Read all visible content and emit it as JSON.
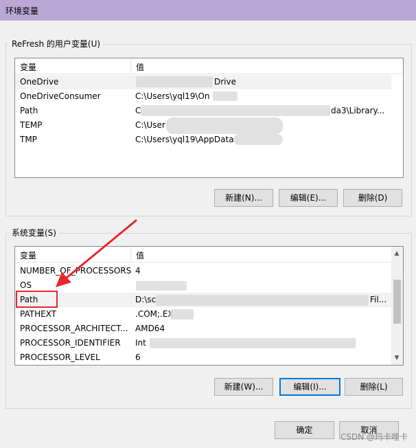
{
  "window": {
    "title": "环境变量"
  },
  "user_vars": {
    "label": "ReFresh 的用户变量(U)",
    "headers": [
      "变量",
      "值"
    ],
    "rows": [
      {
        "name": "OneDrive",
        "value": "Drive"
      },
      {
        "name": "OneDriveConsumer",
        "value": "C:\\Users\\yql19\\On"
      },
      {
        "name": "Path",
        "value": "C",
        "value_tail": "da3\\Library..."
      },
      {
        "name": "TEMP",
        "value": "C:\\User"
      },
      {
        "name": "TMP",
        "value": "C:\\Users\\yql19\\AppData"
      }
    ],
    "buttons": {
      "new": "新建(N)...",
      "edit": "编辑(E)...",
      "delete": "删除(D)"
    }
  },
  "system_vars": {
    "label": "系统变量(S)",
    "headers": [
      "变量",
      "值"
    ],
    "rows": [
      {
        "name": "NUMBER_OF_PROCESSORS",
        "value": "4"
      },
      {
        "name": "OS",
        "value": ""
      },
      {
        "name": "Path",
        "value": "D:\\sc",
        "value_tail": "Fil..."
      },
      {
        "name": "PATHEXT",
        "value": ".COM;.EX"
      },
      {
        "name": "PROCESSOR_ARCHITECT...",
        "value": "AMD64"
      },
      {
        "name": "PROCESSOR_IDENTIFIER",
        "value": "Int"
      },
      {
        "name": "PROCESSOR_LEVEL",
        "value": "6"
      }
    ],
    "buttons": {
      "new": "新建(W)...",
      "edit": "编辑(I)...",
      "delete": "删除(L)"
    }
  },
  "footer": {
    "ok": "确定",
    "cancel": "取消"
  },
  "watermark": "CSDN @玛卡哩卡",
  "colors": {
    "titlebar": "#b9a7d6",
    "annotation": "#e8262a",
    "focus": "#0078d7"
  }
}
